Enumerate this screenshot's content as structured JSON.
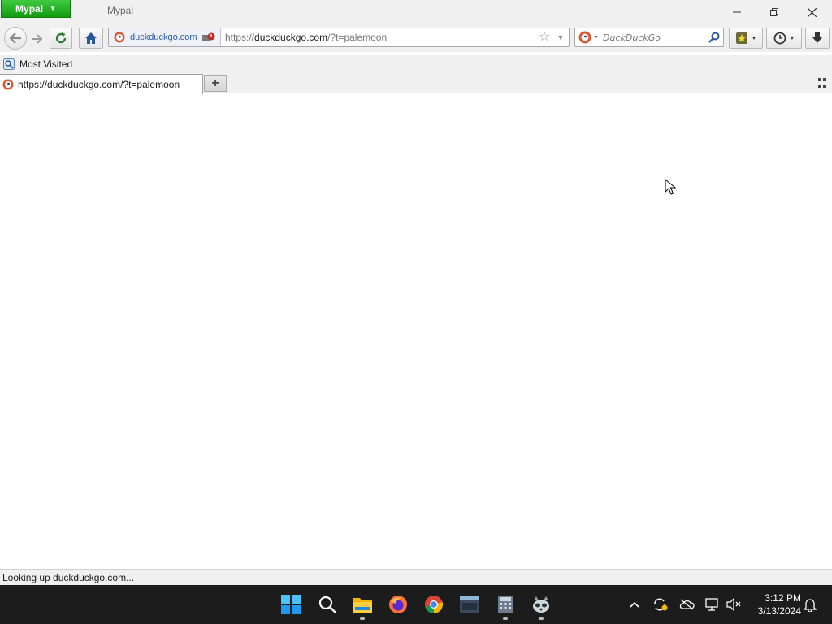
{
  "window": {
    "app_menu_label": "Mypal",
    "title": "Mypal"
  },
  "navbar": {
    "identity_host": "duckduckgo.com",
    "url_prefix": "https://",
    "url_host": "duckduckgo.com",
    "url_path": "/?t=palemoon",
    "search_placeholder": "DuckDuckGo"
  },
  "bookmarks_bar": {
    "items": [
      {
        "label": "Most Visited",
        "icon": "most-visited-icon"
      }
    ]
  },
  "tabs": [
    {
      "title": "https://duckduckgo.com/?t=palemoon",
      "icon": "duckduckgo-favicon",
      "active": true
    }
  ],
  "status": {
    "text": "Looking up duckduckgo.com..."
  },
  "taskbar": {
    "apps": [
      "start-icon",
      "search-icon",
      "file-explorer-icon",
      "firefox-icon",
      "chrome-icon",
      "terminal-icon",
      "calculator-icon",
      "mypal-icon"
    ],
    "clock_time": "3:12 PM",
    "clock_date": "3/13/2024"
  },
  "colors": {
    "app_menu_green": "#139b13",
    "chrome_bg": "#f0f0f0",
    "taskbar_bg": "#1c1c1c",
    "ddg_orange": "#de5833"
  }
}
